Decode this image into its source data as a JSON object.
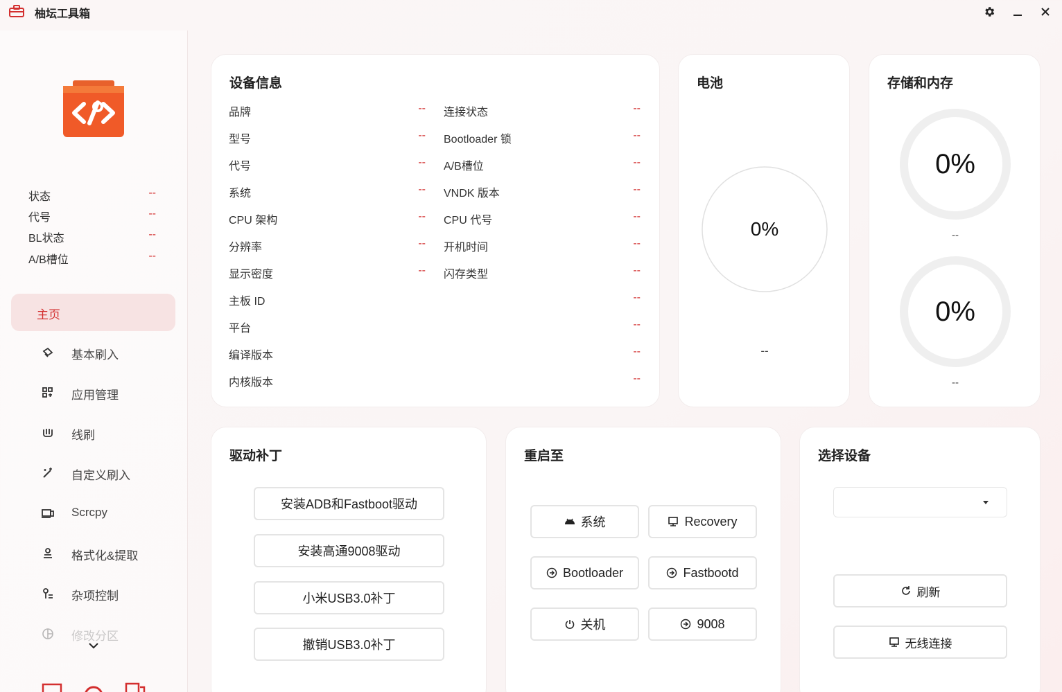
{
  "app": {
    "title": "柚坛工具箱",
    "accent": "#d32f2f"
  },
  "window_controls": {
    "settings": "gear-icon",
    "minimize": "minimize-icon",
    "close": "close-icon"
  },
  "sidebar": {
    "status": [
      {
        "label": "状态",
        "value": "--"
      },
      {
        "label": "代号",
        "value": "--"
      },
      {
        "label": "BL状态",
        "value": "--"
      },
      {
        "label": "A/B槽位",
        "value": "--"
      }
    ],
    "nav": [
      {
        "label": "主页",
        "icon": "home",
        "active": true
      },
      {
        "label": "基本刷入",
        "icon": "flash-icon"
      },
      {
        "label": "应用管理",
        "icon": "apps-icon"
      },
      {
        "label": "线刷",
        "icon": "usb-flash-icon"
      },
      {
        "label": "自定义刷入",
        "icon": "wand-icon"
      },
      {
        "label": "Scrcpy",
        "icon": "screen-mirror-icon"
      },
      {
        "label": "格式化&提取",
        "icon": "format-icon"
      },
      {
        "label": "杂项控制",
        "icon": "misc-icon"
      },
      {
        "label": "修改分区",
        "icon": "partition-icon"
      }
    ]
  },
  "device_info": {
    "title": "设备信息",
    "left": [
      {
        "label": "品牌",
        "value": "--"
      },
      {
        "label": "型号",
        "value": "--"
      },
      {
        "label": "代号",
        "value": "--"
      },
      {
        "label": "系统",
        "value": "--"
      },
      {
        "label": "CPU 架构",
        "value": "--"
      },
      {
        "label": "分辨率",
        "value": "--"
      },
      {
        "label": "显示密度",
        "value": "--"
      }
    ],
    "right": [
      {
        "label": "连接状态",
        "value": "--"
      },
      {
        "label": "Bootloader 锁",
        "value": "--"
      },
      {
        "label": "A/B槽位",
        "value": "--"
      },
      {
        "label": "VNDK 版本",
        "value": "--"
      },
      {
        "label": "CPU 代号",
        "value": "--"
      },
      {
        "label": "开机时间",
        "value": "--"
      },
      {
        "label": "闪存类型",
        "value": "--"
      }
    ],
    "wide": [
      {
        "label": "主板 ID",
        "value": "--"
      },
      {
        "label": "平台",
        "value": "--"
      },
      {
        "label": "编译版本",
        "value": "--"
      },
      {
        "label": "内核版本",
        "value": "--"
      }
    ]
  },
  "battery": {
    "title": "电池",
    "percent": "0%",
    "level": 0,
    "detail": "--"
  },
  "storage": {
    "title": "存储和内存",
    "storage_percent": "0%",
    "storage_level": 0,
    "storage_detail": "--",
    "memory_percent": "0%",
    "memory_level": 0,
    "memory_detail": "--"
  },
  "driver": {
    "title": "驱动补丁",
    "buttons": [
      "安装ADB和Fastboot驱动",
      "安装高通9008驱动",
      "小米USB3.0补丁",
      "撤销USB3.0补丁"
    ]
  },
  "reboot": {
    "title": "重启至",
    "buttons": [
      {
        "label": "系统",
        "icon": "android-icon"
      },
      {
        "label": "Recovery",
        "icon": "monitor-icon"
      },
      {
        "label": "Bootloader",
        "icon": "reboot-icon"
      },
      {
        "label": "Fastbootd",
        "icon": "reboot-icon"
      },
      {
        "label": "关机",
        "icon": "power-icon"
      },
      {
        "label": "9008",
        "icon": "reboot-icon"
      }
    ]
  },
  "select_device": {
    "title": "选择设备",
    "selected": "",
    "refresh_label": "刷新",
    "wireless_label": "无线连接"
  }
}
